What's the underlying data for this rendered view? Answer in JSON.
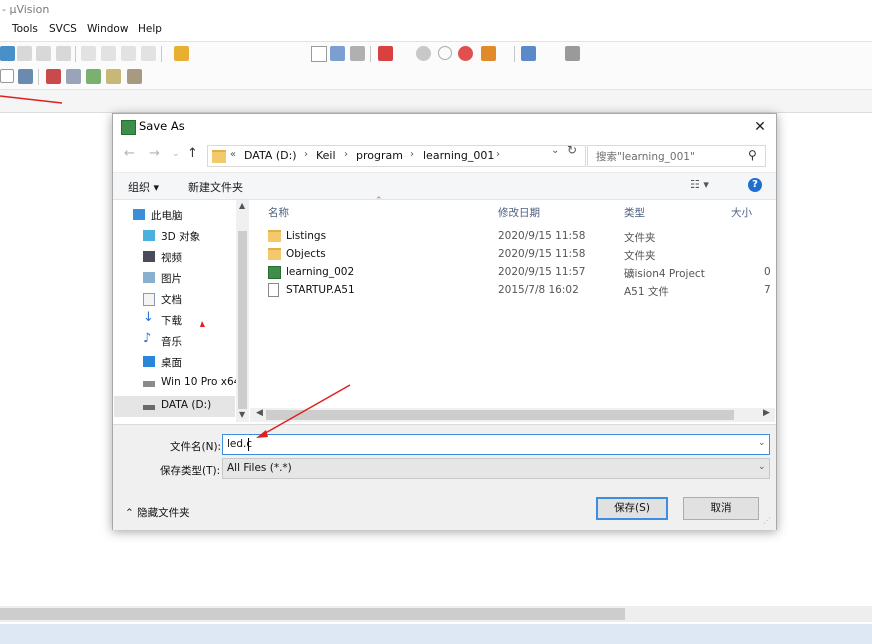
{
  "app": {
    "title": "- µVision",
    "menu": [
      "Tools",
      "SVCS",
      "Window",
      "Help"
    ]
  },
  "dialog": {
    "title": "Save As",
    "close_glyph": "✕",
    "nav": {
      "back": "←",
      "forward": "→",
      "up_history": "⌄",
      "up": "↑"
    },
    "address": {
      "overflow": "«",
      "crumbs": [
        "DATA (D:)",
        "Keil",
        "program",
        "learning_001"
      ],
      "separator": "›"
    },
    "search_placeholder": "搜索\"learning_001\"",
    "toolbar": {
      "organize": "组织 ▾",
      "new_folder": "新建文件夹",
      "view": "☷ ▾",
      "help": "?"
    },
    "nav_items": [
      {
        "label": "此电脑",
        "icon": "computer-icon"
      },
      {
        "label": "3D 对象",
        "icon": "3d-objects-icon"
      },
      {
        "label": "视频",
        "icon": "video-icon"
      },
      {
        "label": "图片",
        "icon": "pictures-icon"
      },
      {
        "label": "文档",
        "icon": "documents-icon"
      },
      {
        "label": "下载",
        "icon": "download-icon"
      },
      {
        "label": "音乐",
        "icon": "music-icon"
      },
      {
        "label": "桌面",
        "icon": "desktop-icon"
      },
      {
        "label": "Win 10 Pro x64",
        "icon": "drive-icon"
      },
      {
        "label": "DATA (D:)",
        "icon": "drive-icon"
      }
    ],
    "columns": {
      "name": "名称",
      "date": "修改日期",
      "type": "类型",
      "size": "大小"
    },
    "files": [
      {
        "name": "Listings",
        "date": "2020/9/15 11:58",
        "type": "文件夹",
        "size": "",
        "icon": "folder-icon"
      },
      {
        "name": "Objects",
        "date": "2020/9/15 11:58",
        "type": "文件夹",
        "size": "",
        "icon": "folder-icon"
      },
      {
        "name": "learning_002",
        "date": "2020/9/15 11:57",
        "type": "礦ision4 Project",
        "size": "0",
        "icon": "uvision-project-icon"
      },
      {
        "name": "STARTUP.A51",
        "date": "2015/7/8 16:02",
        "type": "A51 文件",
        "size": "7",
        "icon": "file-icon"
      }
    ],
    "filename_label": "文件名(N):",
    "filename_value": "led.c",
    "filetype_label": "保存类型(T):",
    "filetype_value": "All Files (*.*)",
    "hide_folders": "⌃ 隐藏文件夹",
    "save_button": "保存(S)",
    "cancel_button": "取消"
  },
  "colors": {
    "annotation_arrow": "#e0201e",
    "focus_blue": "#3c8fe0",
    "help_blue": "#1e6fd0",
    "folder_yellow": "#f3c96b"
  }
}
